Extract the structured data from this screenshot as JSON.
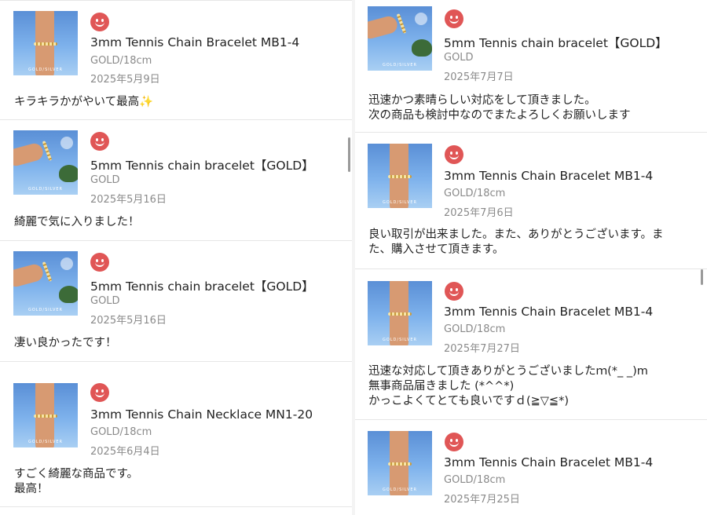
{
  "left_reviews": [
    {
      "rating_icon": "smile-icon",
      "product": "3mm Tennis Chain Bracelet MB1-4",
      "variant": "GOLD/18cm",
      "date": "2025年5月9日",
      "comment": "キラキラかがやいて最高✨"
    },
    {
      "rating_icon": "smile-icon",
      "product": "5mm Tennis chain bracelet【GOLD】",
      "variant": "GOLD",
      "date": "2025年5月16日",
      "comment": "綺麗で気に入りました！"
    },
    {
      "rating_icon": "smile-icon",
      "product": "5mm Tennis chain bracelet【GOLD】",
      "variant": "GOLD",
      "date": "2025年5月16日",
      "comment": "凄い良かったです！"
    },
    {
      "rating_icon": "smile-icon",
      "product": "3mm Tennis Chain Necklace MN1-20",
      "variant": "GOLD/18cm",
      "date": "2025年6月4日",
      "comment": "すごく綺麗な商品です。\n最高！"
    }
  ],
  "right_reviews": [
    {
      "rating_icon": "smile-icon",
      "product": "5mm Tennis chain bracelet【GOLD】",
      "variant": "GOLD",
      "date": "2025年7月7日",
      "comment": "迅速かつ素晴らしい対応をして頂きました。\n次の商品も検討中なのでまたよろしくお願いします"
    },
    {
      "rating_icon": "smile-icon",
      "product": "3mm Tennis Chain Bracelet MB1-4",
      "variant": "GOLD/18cm",
      "date": "2025年7月6日",
      "comment": "良い取引が出来ました。また、ありがとうございます。ま\nた、購入させて頂きます。"
    },
    {
      "rating_icon": "smile-icon",
      "product": "3mm Tennis Chain Bracelet MB1-4",
      "variant": "GOLD/18cm",
      "date": "2025年7月27日",
      "comment": "迅速な対応して頂きありがとうございましたｍ(*_ _)m\n無事商品届きました (*^^*)\nかっこよくてとても良いですｄ(≧▽≦*)"
    },
    {
      "rating_icon": "smile-icon",
      "product": "3mm Tennis Chain Bracelet MB1-4",
      "variant": "GOLD/18cm",
      "date": "2025年7月25日",
      "comment": ""
    }
  ],
  "thumbnail_watermark": "GOLD/SILVER",
  "colors": {
    "smile": "#e05656",
    "meta": "#8a8a8a",
    "divider": "#e6e6e6"
  }
}
